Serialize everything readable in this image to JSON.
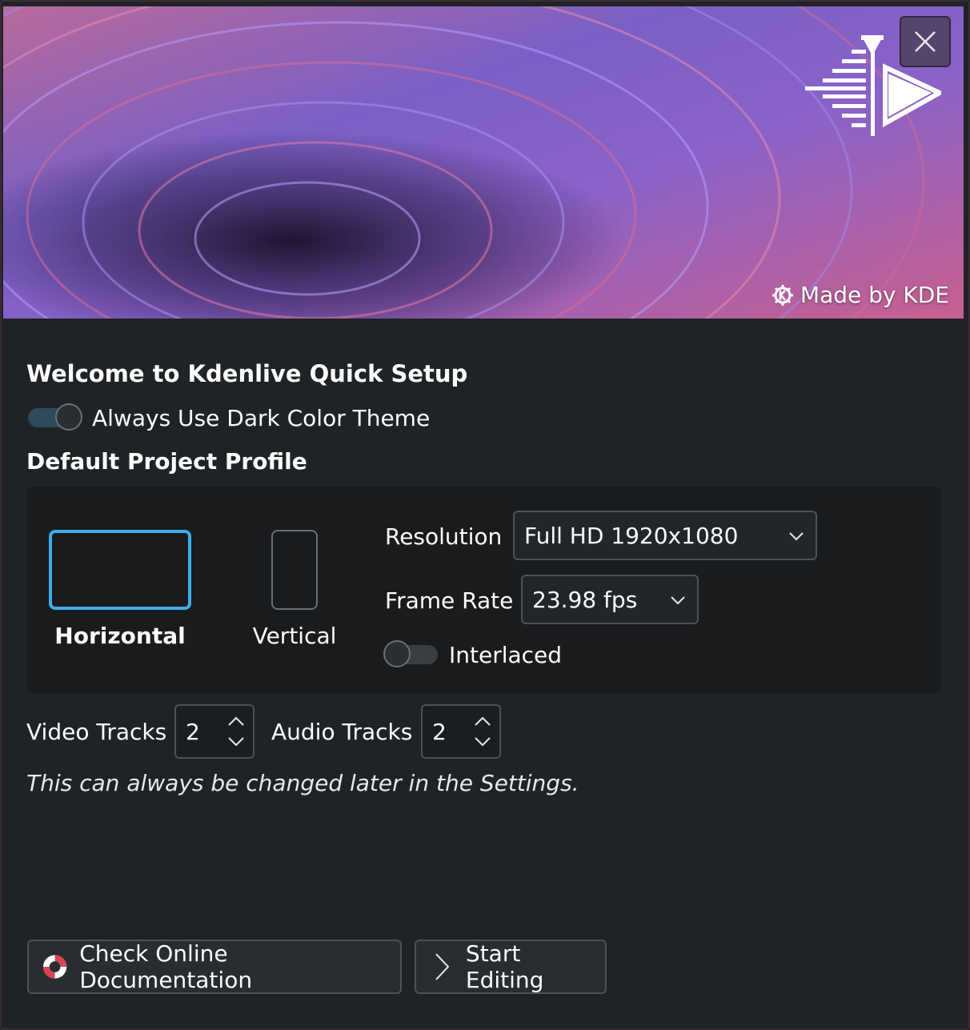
{
  "banner": {
    "made_by": "Made by KDE",
    "close_icon": "close-icon",
    "app_logo": "kdenlive-logo-icon"
  },
  "welcome_title": "Welcome to Kdenlive Quick Setup",
  "dark_theme": {
    "label": "Always Use Dark Color Theme",
    "enabled": true
  },
  "profile": {
    "title": "Default Project Profile",
    "horizontal_label": "Horizontal",
    "vertical_label": "Vertical",
    "selected": "Horizontal",
    "resolution_label": "Resolution",
    "resolution_value": "Full HD 1920x1080",
    "framerate_label": "Frame Rate",
    "framerate_value": "23.98 fps",
    "interlaced_label": "Interlaced",
    "interlaced": false
  },
  "tracks": {
    "video_label": "Video Tracks",
    "video_value": "2",
    "audio_label": "Audio Tracks",
    "audio_value": "2"
  },
  "note": "This can always be changed later in the Settings.",
  "buttons": {
    "docs": "Check Online Documentation",
    "start": "Start Editing"
  },
  "colors": {
    "accent": "#3daee9",
    "background": "#202326",
    "card": "#191b1d"
  }
}
